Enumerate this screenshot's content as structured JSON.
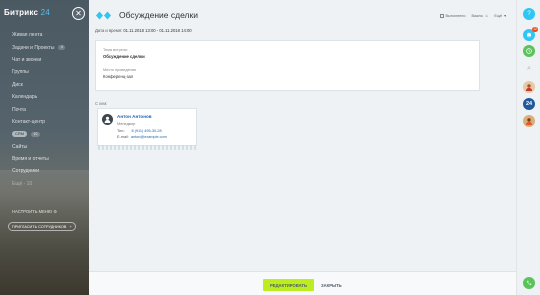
{
  "sidebar": {
    "logo_text": "Битрикс",
    "logo_num": "24",
    "items": [
      {
        "label": "Живая лента",
        "badge": ""
      },
      {
        "label": "Задачи и Проекты",
        "badge": "4"
      },
      {
        "label": "Чат и звонки",
        "badge": ""
      },
      {
        "label": "Группы",
        "badge": ""
      },
      {
        "label": "Диск",
        "badge": ""
      },
      {
        "label": "Календарь",
        "badge": ""
      },
      {
        "label": "Почта",
        "badge": ""
      },
      {
        "label": "Контакт-центр",
        "badge": ""
      },
      {
        "label": "CRM",
        "badge": "10"
      },
      {
        "label": "Сайты",
        "badge": ""
      },
      {
        "label": "Время и отчеты",
        "badge": ""
      },
      {
        "label": "Сотрудники",
        "badge": ""
      },
      {
        "label": "Ещё · 10",
        "badge": ""
      }
    ],
    "settings_label": "НАСТРОИТЬ МЕНЮ",
    "invite_label": "ПРИГЛАСИТЬ СОТРУДНИКОВ"
  },
  "header": {
    "title": "Обсуждение сделки",
    "tools": [
      "Выполнено",
      "Важно",
      "Ещё"
    ],
    "dates_label": "Дата и время:",
    "dates_value": "01.11.2018 13:00 - 01.11.2018 14:00"
  },
  "details": {
    "subject_label": "Тема встречи:",
    "subject_value": "Обсуждение сделки",
    "place_label": "Место проведения",
    "place_value": "Конференц-зал"
  },
  "contact": {
    "with_label": "С кем:",
    "name": "Антон Антонов",
    "position": "Менеджер",
    "phone_label": "Тел.:",
    "phone": "8 (911) 495-30-28",
    "email_label": "E-mail:",
    "email": "anton@example.com"
  },
  "footer": {
    "edit_label": "РЕДАКТИРОВАТЬ",
    "close_label": "ЗАКРЫТЬ"
  },
  "rail": {
    "help": "?",
    "notifications_count": "12",
    "crm_badge": "24"
  },
  "colors": {
    "accent_green": "#bbed21",
    "link_blue": "#2067b0",
    "brand_blue": "#52c2f0",
    "alert_red": "#f54819"
  }
}
